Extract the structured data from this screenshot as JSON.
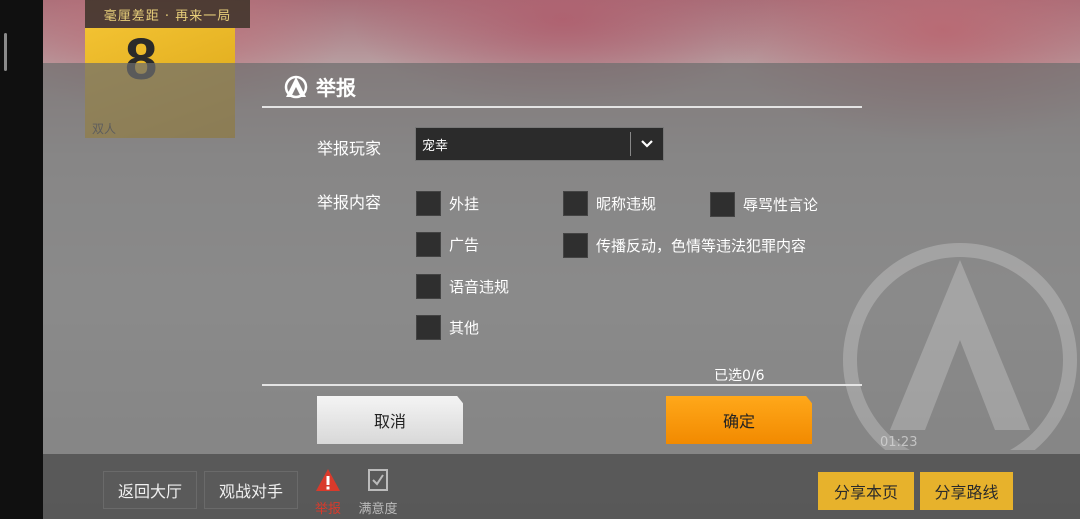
{
  "hud": {
    "rank_tag": "毫厘差距 · 再来一局",
    "rank_number": "8",
    "mode": "双人",
    "timer": "01:23"
  },
  "dialog": {
    "title": "举报",
    "player_label": "举报玩家",
    "player_value": "宠幸",
    "content_label": "举报内容",
    "options": [
      "外挂",
      "昵称违规",
      "辱骂性言论",
      "广告",
      "传播反动，色情等违法犯罪内容",
      "语音违规",
      "其他"
    ],
    "selected_count": "已选0/6",
    "cancel": "取消",
    "confirm": "确定"
  },
  "bottom": {
    "back_lobby": "返回大厅",
    "spectate": "观战对手",
    "report": "举报",
    "satisfaction": "满意度",
    "share_page": "分享本页",
    "share_route": "分享路线"
  },
  "colors": {
    "accent_orange": "#f28a00",
    "gold": "#e7b22c",
    "report_red": "#d93a2b"
  }
}
